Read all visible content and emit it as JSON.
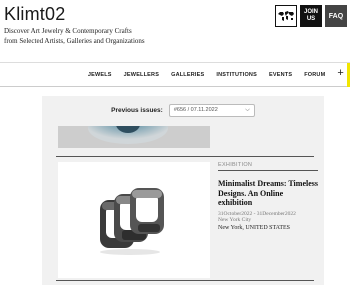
{
  "header": {
    "logo": "Klimt02",
    "tagline_1": "Discover Art Jewelry & Contemporary Crafts",
    "tagline_2": "from Selected Artists, Galleries and Organizations",
    "join_line1": "JOIN",
    "join_line2": "US",
    "faq_label": "FAQ"
  },
  "nav": {
    "items": [
      "JEWELS",
      "JEWELLERS",
      "GALLERIES",
      "INSTITUTIONS",
      "EVENTS",
      "FORUM"
    ],
    "plus": "+"
  },
  "issues": {
    "label": "Previous issues:",
    "selected": "#656 / 07.11.2022"
  },
  "article": {
    "kicker": "EXHIBITION",
    "title": "Minimalist Dreams: Timeless Designs. An Online exhibition",
    "dates": "31October2022 - 31December2022",
    "city": "New York City",
    "venue": "New York, UNITED STATES"
  }
}
